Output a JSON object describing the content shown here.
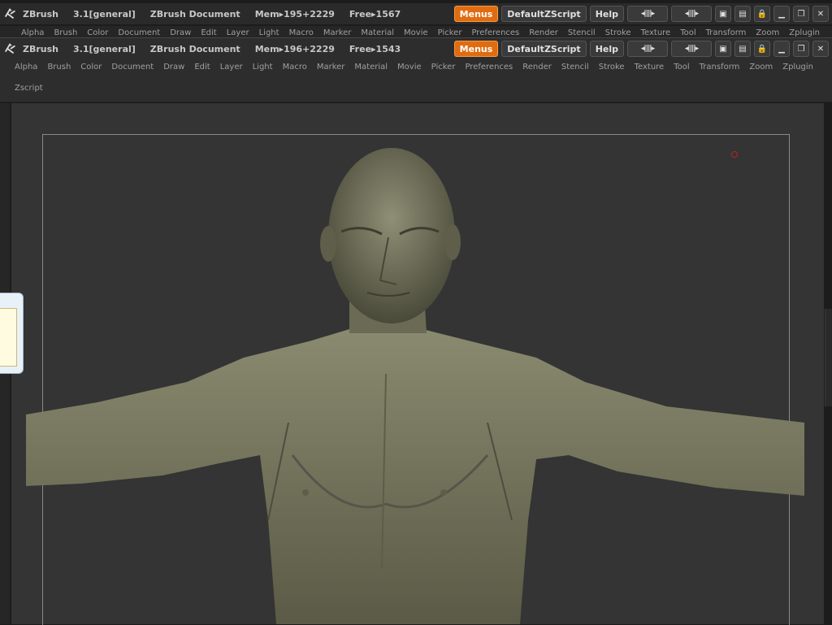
{
  "back_window": {
    "title": {
      "app": "ZBrush",
      "version": "3.1[general]",
      "document": "ZBrush Document",
      "mem": "Mem▸195+2229",
      "free": "Free▸1567"
    },
    "buttons": {
      "menus": "Menus",
      "script": "DefaultZScript",
      "help": "Help"
    },
    "menu_items": [
      "Alpha",
      "Brush",
      "Color",
      "Document",
      "Draw",
      "Edit",
      "Layer",
      "Light",
      "Macro",
      "Marker",
      "Material",
      "Movie",
      "Picker",
      "Preferences",
      "Render",
      "Stencil",
      "Stroke",
      "Texture",
      "Tool",
      "Transform",
      "Zoom",
      "Zplugin"
    ]
  },
  "front_window": {
    "title": {
      "app": "ZBrush",
      "version": "3.1[general]",
      "document": "ZBrush Document",
      "mem": "Mem▸196+2229",
      "free": "Free▸1543"
    },
    "buttons": {
      "menus": "Menus",
      "script": "DefaultZScript",
      "help": "Help"
    },
    "menu_items": [
      "Alpha",
      "Brush",
      "Color",
      "Document",
      "Draw",
      "Edit",
      "Layer",
      "Light",
      "Macro",
      "Marker",
      "Material",
      "Movie",
      "Picker",
      "Preferences",
      "Render",
      "Stencil",
      "Stroke",
      "Texture",
      "Tool",
      "Transform",
      "Zoom",
      "Zplugin",
      "Zscript"
    ]
  },
  "colors": {
    "accent": "#e06c12",
    "canvas": "#343434",
    "model": "#77775f"
  }
}
